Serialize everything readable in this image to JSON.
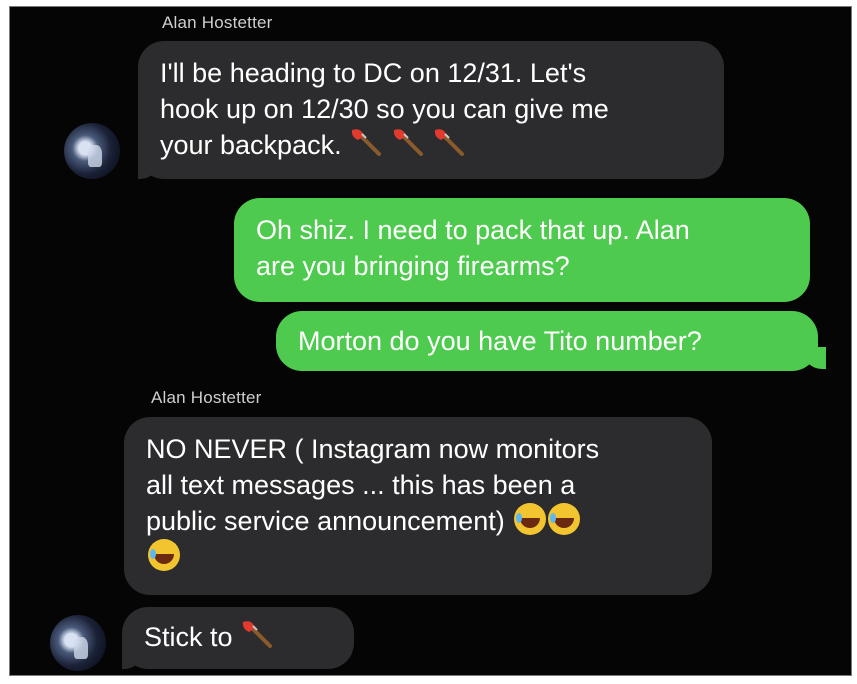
{
  "messages": [
    {
      "sender": "Alan Hostetter",
      "text": "I'll be heading to DC on 12/31. Let's hook up on 12/30 so you can give me your backpack. 🪓🪓🪓",
      "direction": "incoming",
      "line1": "I'll be heading to DC on 12/31. Let's",
      "line2": "hook up on 12/30 so you can give me",
      "line3": "your backpack."
    },
    {
      "text": "Oh shiz. I need to pack that up. Alan are you bringing firearms?",
      "direction": "outgoing",
      "line1": "Oh shiz. I need to pack that up. Alan",
      "line2": "are you bringing firearms?"
    },
    {
      "text": "Morton do you have Tito number?",
      "direction": "outgoing"
    },
    {
      "sender": "Alan Hostetter",
      "text": "NO NEVER ( Instagram now monitors all text messages ... this has been a public service announcement) 😂😂😂",
      "direction": "incoming",
      "line1": "NO NEVER ( Instagram now monitors",
      "line2": "all text messages ... this has been a",
      "line3": "public service announcement)"
    },
    {
      "text": "Stick to 🪓",
      "direction": "incoming",
      "line1": "Stick to"
    }
  ],
  "colors": {
    "incoming_bubble": "#2c2c2e",
    "outgoing_bubble": "#4ecb4e",
    "background": "#050505"
  },
  "icons": {
    "axe": "axe-emoji",
    "laugh": "tears-of-joy-emoji",
    "avatar": "contact-avatar"
  }
}
